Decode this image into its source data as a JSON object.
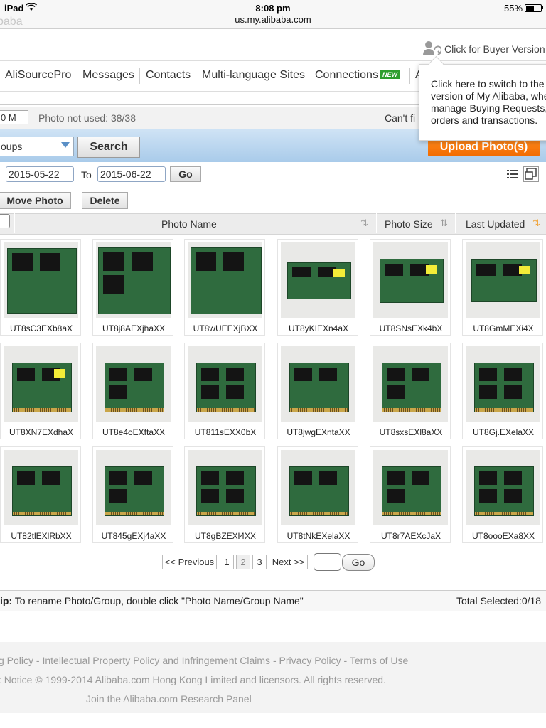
{
  "status_bar": {
    "device": "iPad",
    "time": "8:08 pm",
    "url": "us.my.alibaba.com",
    "battery": "55%",
    "battery_level": 0.55
  },
  "header": {
    "ghost_logo": "baba",
    "buyer_link": "Click for Buyer Version :"
  },
  "tooltip": {
    "lines": [
      "Click here to switch to the b",
      "version of My Alibaba, whe",
      "manage Buying Requests,",
      "orders and transactions."
    ]
  },
  "nav": {
    "items": [
      {
        "label": "AliSourcePro"
      },
      {
        "label": "Messages"
      },
      {
        "label": "Contacts"
      },
      {
        "label": "Multi-language Sites"
      },
      {
        "label": "Connections"
      },
      {
        "label": "A"
      }
    ],
    "new_badge": "NEW"
  },
  "storage": {
    "value": "0 M",
    "photo_not_used": "Photo not used: 38/38",
    "cant_find": "Can't fi"
  },
  "search": {
    "group_value": "oups",
    "search_label": "Search",
    "upload_label": "Upload Photo(s)"
  },
  "date_filter": {
    "from": "2015-05-22",
    "to_label": "To",
    "to": "2015-06-22",
    "go_label": "Go"
  },
  "actions": {
    "move": "Move Photo",
    "delete": "Delete"
  },
  "table_header": {
    "photo_name": "Photo Name",
    "photo_size": "Photo Size",
    "last_updated": "Last Updated"
  },
  "photos": [
    {
      "name": "UT8sC3EXb8aX"
    },
    {
      "name": "UT8j8AEXjhaXX"
    },
    {
      "name": "UT8wUEEXjBXX"
    },
    {
      "name": "UT8yKIEXn4aX"
    },
    {
      "name": "UT8SNsEXk4bX"
    },
    {
      "name": "UT8GmMEXi4X"
    },
    {
      "name": "UT8XN7EXdhaX"
    },
    {
      "name": "UT8e4oEXftaXX"
    },
    {
      "name": "UT811sEXX0bX"
    },
    {
      "name": "UT8jwgEXntaXX"
    },
    {
      "name": "UT8sxsEXl8aXX"
    },
    {
      "name": "UT8Gj.EXelaXX"
    },
    {
      "name": "UT82tlEXlRbXX"
    },
    {
      "name": "UT845gEXj4aXX"
    },
    {
      "name": "UT8gBZEXl4XX"
    },
    {
      "name": "UT8tNkEXelaXX"
    },
    {
      "name": "UT8r7AEXcJaX"
    },
    {
      "name": "UT8oooEXa8XX"
    }
  ],
  "pagination": {
    "prev": "<< Previous",
    "pages": [
      "1",
      "2",
      "3"
    ],
    "current": "2",
    "next": "Next >>",
    "go": "Go"
  },
  "tip": {
    "text": "ip: To rename Photo/Group, double click \"Photo Name/Group Name\"",
    "total_selected": "Total Selected:0/18"
  },
  "footer": {
    "line1": "g Policy - Intellectual Property Policy and Infringement Claims - Privacy Policy - Terms of Use",
    "line2": ": Notice © 1999-2014 Alibaba.com Hong Kong Limited and licensors. All rights reserved.",
    "line3": "Join the Alibaba.com Research Panel"
  },
  "colors": {
    "upload_orange": "#f26b00",
    "band_blue": "#b8d5ee",
    "new_badge_green": "#2e9e2e",
    "sort_active_orange": "#f0a030"
  }
}
